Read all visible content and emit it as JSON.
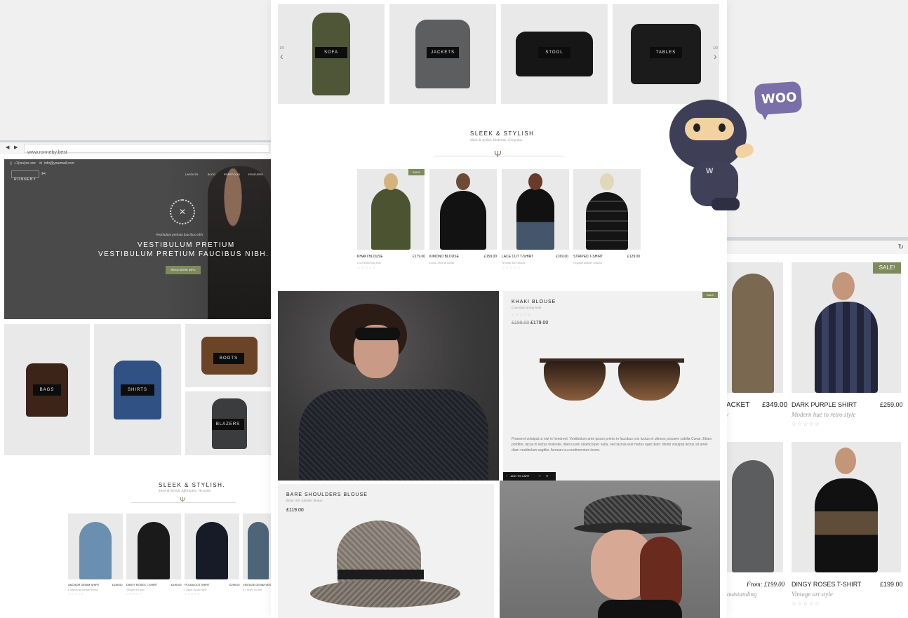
{
  "carousel": {
    "left_counter": "1/9",
    "right_counter": "1/9",
    "items": [
      {
        "label": "SOFA"
      },
      {
        "label": "JACKETS"
      },
      {
        "label": "STOOL"
      },
      {
        "label": "TABLES"
      }
    ]
  },
  "center_section": {
    "title": "SLEEK & STYLISH",
    "subtitle": "Sleek & stylish. Moderate. Gorgeous."
  },
  "center_products": [
    {
      "name": "KHAKI BLOUSE",
      "price": "£179.00",
      "desc": "Cool and strong look",
      "badge": "SALE!"
    },
    {
      "name": "KIMONO BLOUSE",
      "price": "£159.00",
      "desc": "Loose, chick & stylish"
    },
    {
      "name": "LACE CUT T-SHIRT",
      "price": "£169.00",
      "desc": "Versatile lace details"
    },
    {
      "name": "STRIPED T-SHIRT",
      "price": "£129.00",
      "desc": "Original summer solution"
    }
  ],
  "featured": {
    "badge": "SALE",
    "name": "KHAKI BLOUSE",
    "desc": "Cool and strong look",
    "old_price": "£199.00",
    "price": "£179.00",
    "body": "Praesent volutpat ut nisl in hendrerit. Vestibulum ante ipsum primis in faucibus orci luctus et ultrices posuere cubilia Curae. Etiam porttitor, lacus in luctus molestie, libero justo ullamcorper nulla, sed lacinia erat metus eget diam. Morbi volutpat lectus sit amet diam vestibulum sagittis. Aenean eu condimentum lorem.",
    "add_to_cart": "ADD TO CART"
  },
  "bare": {
    "name": "BARE SHOULDERS BLOUSE",
    "desc": "Boho chic summer blouse",
    "price": "£119.00"
  },
  "left_browser": {
    "url": "www.ronneby.best",
    "phone": "+1(xxx)xx-xxx",
    "email": "info@yourmail.com",
    "logo": "RONNEBY",
    "nav": [
      "LAYOUTS",
      "BLOG",
      "PORTFOLIO",
      "FEATURES"
    ],
    "hero_small": "Vestibulum pretium faucibus nibh",
    "hero_line1": "VESTIBULUM PRETIUM",
    "hero_line2": "VESTIBULUM PRETIUM FAUCIBUS NIBH.",
    "hero_button": "READ MORE INFO",
    "categories": [
      "BAGS",
      "SHIRTS",
      "BOOTS",
      "BLAZERS"
    ],
    "section_title": "SLEEK & STYLISH.",
    "section_subtitle": "Sleek & Stylish. Affordable. Versatile.",
    "products": [
      {
        "name": "ANCHOR DENIM SHIRT",
        "price": "£189.00",
        "desc": "Comforting summer blend"
      },
      {
        "name": "DINGY ROSES T-SHIRT",
        "price": "£199.00",
        "desc": "Vintage art style"
      },
      {
        "name": "POLKA DOT SHIRT",
        "price": "£299.00",
        "desc": "Casual classic style"
      },
      {
        "name": "VINTAGE DENIM VEST",
        "price": "",
        "desc": "It's never too late"
      }
    ]
  },
  "right_browser": {
    "products": [
      {
        "name": "JACKET",
        "price": "£349.00",
        "desc": "cy"
      },
      {
        "name": "DARK PURPLE SHIRT",
        "price": "£259.00",
        "desc": "Modern hue to retro style",
        "badge": "SALE!"
      },
      {
        "name": "",
        "price": "From: £199.00",
        "desc": "outstanding"
      },
      {
        "name": "DINGY ROSES T-SHIRT",
        "price": "£199.00",
        "desc": "Vintage art style"
      }
    ]
  },
  "woo": {
    "label": "WOO"
  },
  "colors": {
    "accent": "#7d8a5c",
    "dark": "#111111",
    "hero_bg": "#4b4b4b"
  }
}
